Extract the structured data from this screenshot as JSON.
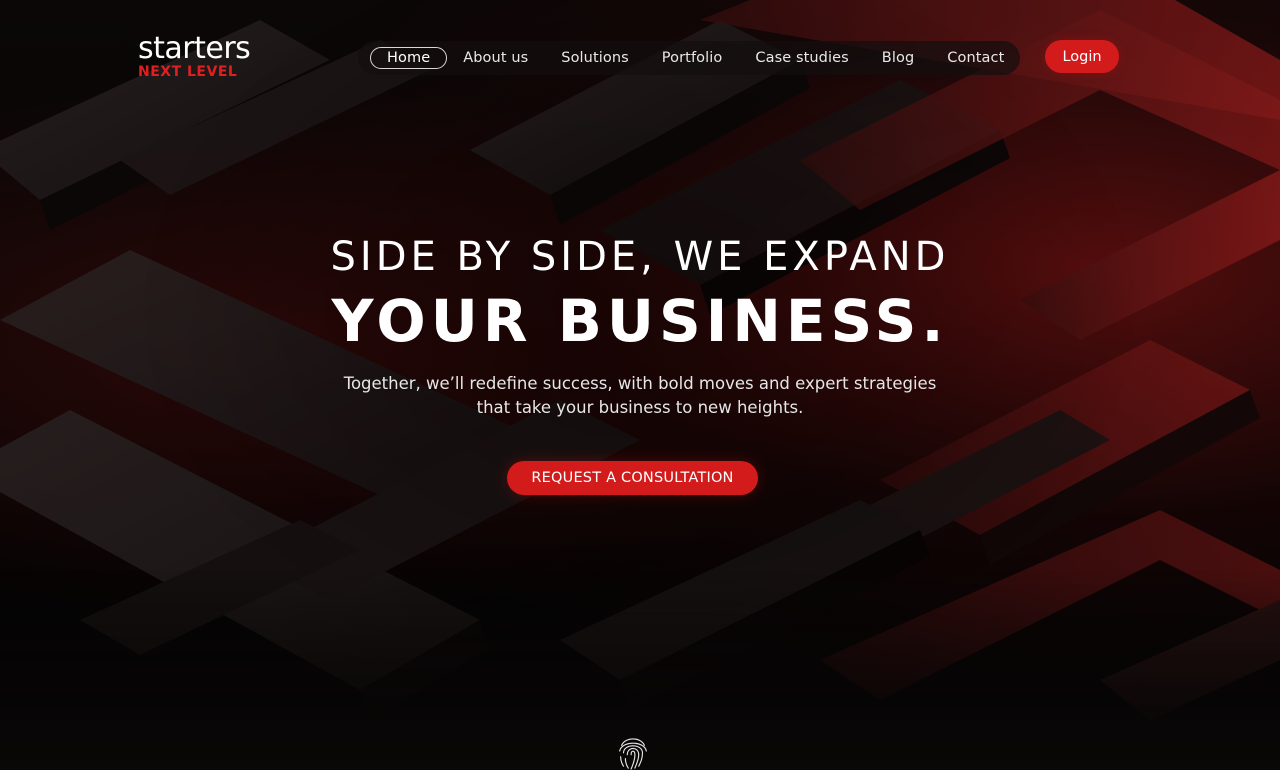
{
  "brand": {
    "name": "starters",
    "tagline": "NEXT LEVEL",
    "accent_color": "#d41b1b"
  },
  "nav": {
    "items": [
      {
        "label": "Home",
        "active": true
      },
      {
        "label": "About us"
      },
      {
        "label": "Solutions"
      },
      {
        "label": "Portfolio"
      },
      {
        "label": "Case studies"
      },
      {
        "label": "Blog"
      },
      {
        "label": "Contact"
      }
    ],
    "login_label": "Login"
  },
  "hero": {
    "line1": "SIDE BY SIDE, WE EXPAND",
    "line2": "YOUR BUSINESS.",
    "description": "Together, we’ll redefine success, with bold moves and expert strategies that take your business to new heights.",
    "cta_label": "REQUEST A CONSULTATION"
  },
  "icons": {
    "scroll_indicator": "fingerprint-icon"
  }
}
